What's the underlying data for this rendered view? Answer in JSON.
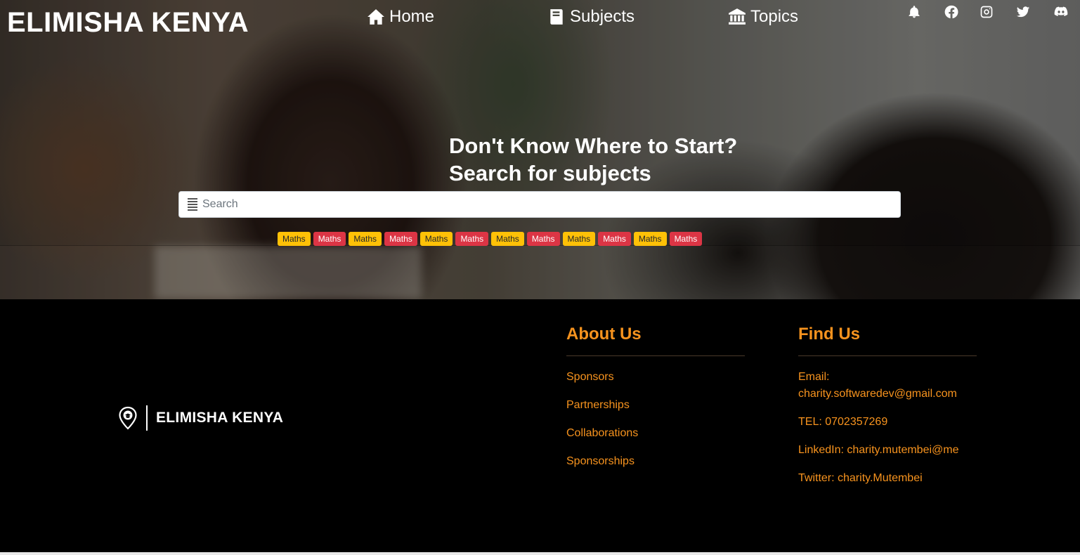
{
  "header": {
    "brand": "ELIMISHA KENYA",
    "nav": [
      {
        "label": "Home",
        "icon": "home-icon"
      },
      {
        "label": "Subjects",
        "icon": "book-icon"
      },
      {
        "label": "Topics",
        "icon": "bank-icon"
      }
    ],
    "social_icons": [
      "bell-icon",
      "facebook-icon",
      "instagram-icon",
      "twitter-icon",
      "discord-icon"
    ]
  },
  "hero": {
    "headline_line1": "Don't Know Where to Start?",
    "headline_line2": "Search for subjects",
    "search_placeholder": "Search",
    "tags": [
      {
        "label": "Maths",
        "color": "yellow"
      },
      {
        "label": "Maths",
        "color": "red"
      },
      {
        "label": "Maths",
        "color": "yellow"
      },
      {
        "label": "Maths",
        "color": "red"
      },
      {
        "label": "Maths",
        "color": "yellow"
      },
      {
        "label": "Maths",
        "color": "red"
      },
      {
        "label": "Maths",
        "color": "yellow"
      },
      {
        "label": "Maths",
        "color": "red"
      },
      {
        "label": "Maths",
        "color": "yellow"
      },
      {
        "label": "Maths",
        "color": "red"
      },
      {
        "label": "Maths",
        "color": "yellow"
      },
      {
        "label": "Maths",
        "color": "red"
      }
    ]
  },
  "footer": {
    "brand": "ELIMISHA KENYA",
    "about": {
      "title": "About Us",
      "links": [
        "Sponsors",
        "Partnerships",
        "Collaborations",
        "Sponsorships"
      ]
    },
    "find": {
      "title": "Find Us",
      "items": [
        "Email: charity.softwaredev@gmail.com",
        "TEL: 0702357269",
        "LinkedIn: charity.mutembei@me",
        "Twitter: charity.Mutembei"
      ]
    }
  },
  "colors": {
    "accent": "#f7931e",
    "tag_yellow": "#ffc107",
    "tag_red": "#dc3545"
  }
}
